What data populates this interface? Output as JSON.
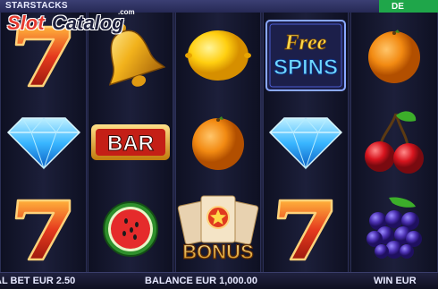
{
  "header": {
    "game_title": "STARSTACKS",
    "demo_label": "DE"
  },
  "logo": {
    "slot": "Slot",
    "catalog": "Catalog",
    "com": ".com"
  },
  "reels": [
    [
      "seven",
      "diamond",
      "seven"
    ],
    [
      "bell",
      "bar",
      "watermelon"
    ],
    [
      "lemon",
      "orange",
      "bonus"
    ],
    [
      "free-spins",
      "diamond",
      "seven"
    ],
    [
      "orange",
      "cherry",
      "grapes"
    ]
  ],
  "symbols": {
    "bar_text": "BAR",
    "free_text": "Free",
    "spins_text": "SPINS",
    "bonus_text": "BONUS"
  },
  "footer": {
    "total_bet": "AL BET EUR 2.50",
    "balance": "BALANCE EUR 1,000.00",
    "win": "WIN EUR"
  },
  "colors": {
    "demo_green": "#1fa64a",
    "seven_red": "#e53a1e",
    "diamond_blue": "#39b6ff",
    "orange": "#f28a12"
  }
}
